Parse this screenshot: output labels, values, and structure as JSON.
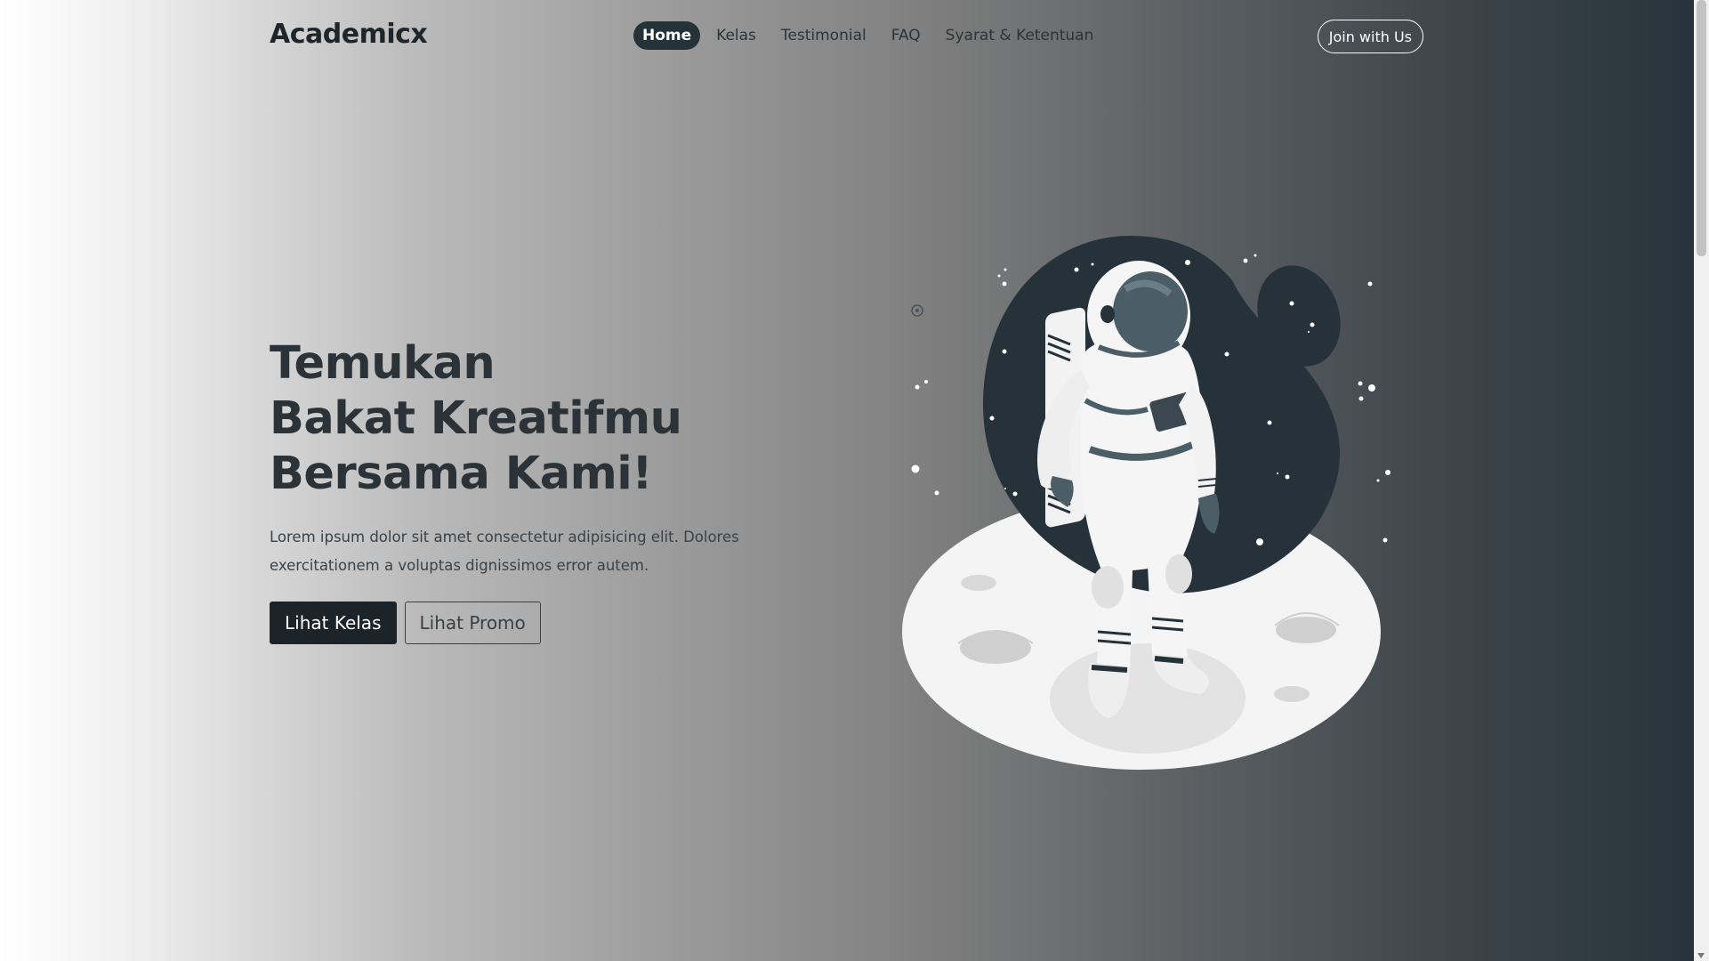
{
  "brand": {
    "name": "Academicx"
  },
  "nav": {
    "items": [
      {
        "label": "Home",
        "active": true
      },
      {
        "label": "Kelas",
        "active": false
      },
      {
        "label": "Testimonial",
        "active": false
      },
      {
        "label": "FAQ",
        "active": false
      },
      {
        "label": "Syarat & Ketentuan",
        "active": false
      }
    ],
    "cta_label": "Join with Us"
  },
  "hero": {
    "title_lines": [
      "Temukan",
      "Bakat Kreatifmu",
      "Bersama Kami!"
    ],
    "description": "Lorem ipsum dolor sit amet consectetur adipisicing elit. Dolores exercitationem a voluptas dignissimos error autem.",
    "primary_button": "Lihat Kelas",
    "secondary_button": "Lihat Promo"
  },
  "illustration": {
    "icon": "astronaut-on-moon-illustration"
  },
  "colors": {
    "dark": "#26323a",
    "accent_gray": "#4b5d66",
    "moon": "#f2f2f2"
  }
}
